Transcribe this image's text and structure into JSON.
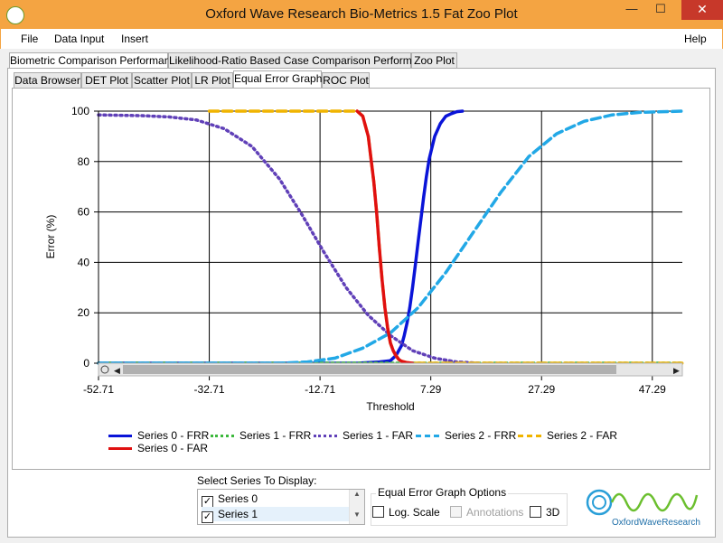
{
  "window": {
    "title": "Oxford Wave Research Bio-Metrics 1.5 Fat Zoo Plot",
    "minimize": "—",
    "maximize": "☐",
    "close": "✕"
  },
  "menu": {
    "file": "File",
    "data_input": "Data Input",
    "insert": "Insert",
    "help": "Help"
  },
  "outer_tabs": [
    "Biometric Comparison Performance",
    "Likelihood-Ratio Based Case Comparison Performance",
    "Zoo Plot"
  ],
  "inner_tabs": [
    "Data Browser",
    "DET Plot",
    "Scatter Plot",
    "LR Plot",
    "Equal Error Graph",
    "ROC Plot"
  ],
  "colors": {
    "series0_frr": "#0a14d8",
    "series1_frr": "#3cb83c",
    "series1_far": "#6040b8",
    "series2_frr": "#22a8e6",
    "series2_far": "#f0b400",
    "series0_far": "#e01010"
  },
  "chart_data": {
    "type": "line",
    "xlabel": "Threshold",
    "ylabel": "Error (%)",
    "xlim": [
      -52.71,
      52.71
    ],
    "ylim": [
      0,
      100
    ],
    "x_ticks": [
      "-52.71",
      "-32.71",
      "-12.71",
      "7.29",
      "27.29",
      "47.29"
    ],
    "y_ticks": [
      "0",
      "20",
      "40",
      "60",
      "80",
      "100"
    ],
    "grid": true,
    "legend_position": "bottom",
    "series": [
      {
        "name": "Series 0 - FRR",
        "style": "solid",
        "x": [
          -52.71,
          -6,
          -2,
          0,
          1,
          2,
          2.5,
          3,
          3.5,
          4,
          4.5,
          5,
          5.5,
          6,
          6.5,
          7,
          8,
          9,
          10,
          11,
          12,
          13
        ],
        "y": [
          0,
          0,
          0.5,
          1,
          3,
          7,
          11,
          16,
          22,
          30,
          39,
          48,
          57,
          66,
          74,
          81,
          90,
          95,
          98,
          99,
          99.8,
          100
        ]
      },
      {
        "name": "Series 1 - FRR",
        "style": "dotted",
        "x": [
          -52.71,
          -40,
          -30,
          -20,
          -10,
          0,
          10,
          20,
          30,
          40,
          52.71
        ],
        "y": [
          0,
          0,
          0,
          0,
          0,
          0,
          0,
          0,
          0,
          0,
          0
        ]
      },
      {
        "name": "Series 1 - FAR",
        "style": "dotted",
        "x": [
          -52.71,
          -45,
          -40,
          -35,
          -30,
          -25,
          -20,
          -16,
          -12,
          -8,
          -4,
          0,
          4,
          8,
          12,
          16
        ],
        "y": [
          98.5,
          98.2,
          97.7,
          96.5,
          93,
          86,
          73,
          59,
          44,
          30,
          19,
          11,
          5,
          2,
          0.5,
          0
        ]
      },
      {
        "name": "Series 2 - FRR",
        "style": "dashed",
        "x": [
          -52.71,
          -20,
          -15,
          -10,
          -5,
          0,
          5,
          10,
          15,
          20,
          25,
          30,
          35,
          40,
          45,
          52.71
        ],
        "y": [
          0,
          0,
          0.5,
          2,
          6,
          12,
          22,
          36,
          52,
          68,
          82,
          91,
          96,
          98.5,
          99.5,
          100
        ]
      },
      {
        "name": "Series 2 - FAR",
        "style": "dashed",
        "x": [
          -32.71,
          -6,
          -5,
          -4,
          -3,
          -2.5,
          -2,
          -1.5,
          -1,
          -0.5,
          0,
          0.5,
          1,
          1.5,
          2,
          3,
          4,
          52.71
        ],
        "y": [
          100,
          100,
          98,
          90,
          72,
          60,
          46,
          33,
          22,
          14,
          8,
          5,
          3,
          1.5,
          0.8,
          0.2,
          0,
          0
        ]
      },
      {
        "name": "Series 0 - FAR",
        "style": "solid",
        "x": [
          -6,
          -5,
          -4,
          -3,
          -2.5,
          -2,
          -1.5,
          -1,
          -0.5,
          0,
          0.5,
          1,
          1.5,
          2,
          3,
          4
        ],
        "y": [
          100,
          98,
          90,
          72,
          60,
          46,
          33,
          22,
          14,
          8,
          5,
          3,
          1.5,
          0.8,
          0.2,
          0
        ]
      }
    ]
  },
  "legend": [
    "Series 0 - FRR",
    "Series 1 - FRR",
    "Series 1 - FAR",
    "Series 2 - FRR",
    "Series 2 - FAR",
    "Series 0 - FAR"
  ],
  "series_select": {
    "label": "Select Series To Display:",
    "items": [
      {
        "label": "Series 0",
        "checked": true
      },
      {
        "label": "Series 1",
        "checked": true
      }
    ]
  },
  "options": {
    "title": "Equal Error Graph Options",
    "log_scale": "Log. Scale",
    "annotations": "Annotations",
    "three_d": "3D"
  },
  "logo": {
    "text": "OxfordWaveResearch"
  }
}
